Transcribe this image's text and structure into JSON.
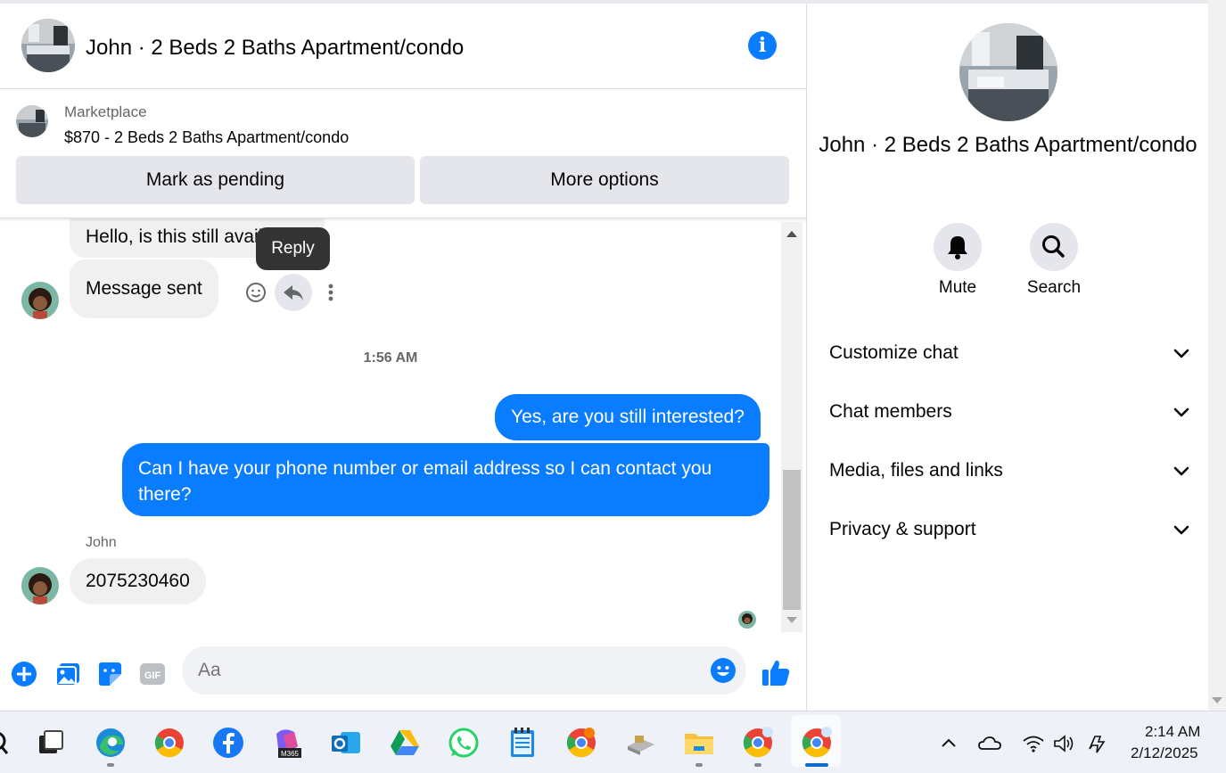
{
  "header": {
    "title": "John · 2 Beds 2 Baths Apartment/condo"
  },
  "marketplace": {
    "label": "Marketplace",
    "listing": "$870 - 2 Beds 2 Baths Apartment/condo",
    "mark_pending": "Mark as pending",
    "more_options": "More options"
  },
  "messages": {
    "m1": "Hello, is this still available?",
    "m2": "Message sent",
    "tooltip": "Reply",
    "timestamp": "1:56 AM",
    "out1": "Yes, are you still interested?",
    "out2": "Can I have your phone number or email address so I can contact you there?",
    "sender": "John",
    "in3": "2075230460"
  },
  "composer": {
    "placeholder": "Aa",
    "gif": "GIF"
  },
  "side": {
    "name": "John · 2 Beds 2 Baths Apartment/condo",
    "mute": "Mute",
    "search": "Search",
    "menu": [
      "Customize chat",
      "Chat members",
      "Media, files and links",
      "Privacy & support"
    ]
  },
  "taskbar": {
    "time": "2:14 AM",
    "date": "2/12/2025",
    "m365": "M365"
  },
  "colors": {
    "accent": "#0a7cff",
    "bubble_in": "#f0f0f0"
  }
}
